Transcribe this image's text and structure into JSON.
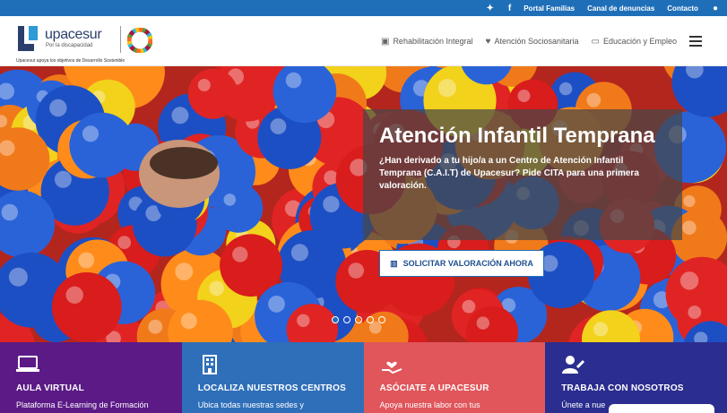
{
  "topbar": {
    "icons": [
      "twitter-icon",
      "facebook-icon",
      "user-icon"
    ],
    "links": [
      "Portal Familias",
      "Canal de denuncias",
      "Contacto"
    ]
  },
  "header": {
    "logo_name": "upacesur",
    "logo_sub": "Por la discapacidad",
    "logo_tagline": "Upacesur apoya los objetivos de Desarrollo Sostenible",
    "nav": [
      {
        "label": "Rehabilitación Integral",
        "icon": "medkit-icon"
      },
      {
        "label": "Atención Sociosanitaria",
        "icon": "heartbeat-icon"
      },
      {
        "label": "Educación y Empleo",
        "icon": "monitor-icon"
      }
    ],
    "menu_icon": "hamburger-icon"
  },
  "hero": {
    "title": "Atención Infantil Temprana",
    "text": "¿Han derivado a tu hijo/a a un Centro de Atención Infantil Temprana (C.A.I.T) de Upacesur? Pide CITA para una primera valoración.",
    "button": "SOLICITAR VALORACIÓN AHORA",
    "button_icon": "building-icon",
    "slide_count": 5,
    "active_slide": 1
  },
  "cards": [
    {
      "title": "AULA VIRTUAL",
      "desc": "Plataforma E-Learning de Formación",
      "icon": "laptop-icon",
      "color": "#5b1a86"
    },
    {
      "title": "LOCALIZA NUESTROS CENTROS",
      "desc": "Ubica todas nuestras sedes y",
      "icon": "building-icon",
      "color": "#2f6fb9"
    },
    {
      "title": "ASÓCIATE A UPACESUR",
      "desc": "Apoya nuestra labor con tus",
      "icon": "hand-heart-icon",
      "color": "#e0565b"
    },
    {
      "title": "TRABAJA CON NOSOTROS",
      "desc": "Únete a nue",
      "icon": "user-edit-icon",
      "color": "#2b2d8f"
    }
  ]
}
